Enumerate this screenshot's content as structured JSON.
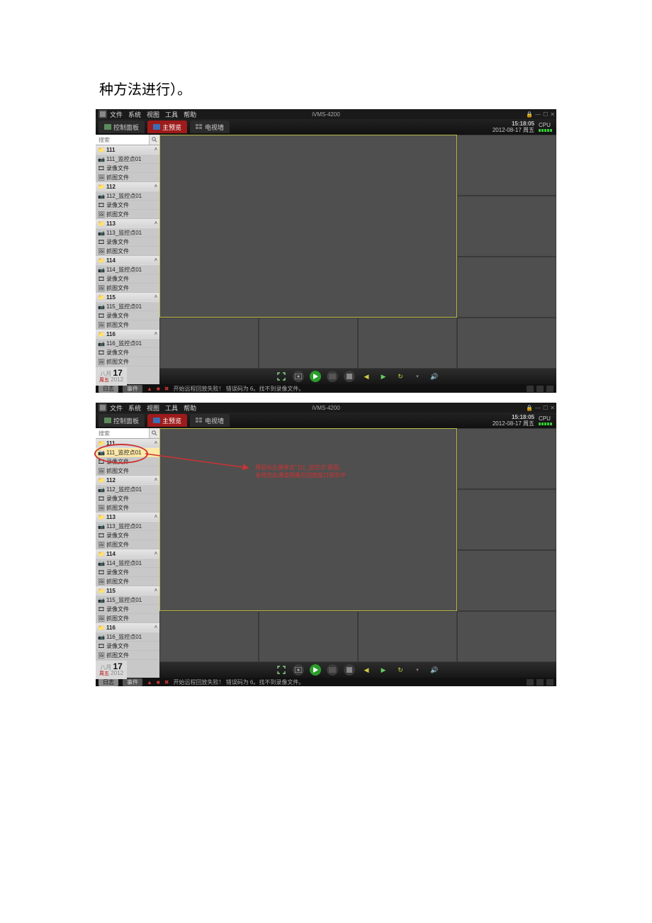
{
  "caption": "种方法进行）。",
  "app": {
    "title": "iVMS-4200",
    "menus": [
      "文件",
      "系统",
      "视图",
      "工具",
      "帮助"
    ],
    "window_buttons": [
      "lock-icon",
      "minimize-icon",
      "maximize-icon",
      "close-icon"
    ]
  },
  "tabs": [
    {
      "label": "控制面板",
      "icon": "panel"
    },
    {
      "label": "主预览",
      "icon": "screen",
      "active": true
    },
    {
      "label": "电视墙",
      "icon": "tvwall"
    }
  ],
  "clock": {
    "time": "15:18:05",
    "date": "2012-08-17",
    "weekday": "周五",
    "cpu_label": "CPU"
  },
  "search": {
    "placeholder": "搜索"
  },
  "groups": [
    {
      "name": "111",
      "items": [
        {
          "t": "cam",
          "l": "111_监控点01"
        },
        {
          "t": "rec",
          "l": "录像文件"
        },
        {
          "t": "pic",
          "l": "抓图文件"
        }
      ]
    },
    {
      "name": "112",
      "items": [
        {
          "t": "cam",
          "l": "112_监控点01"
        },
        {
          "t": "rec",
          "l": "录像文件"
        },
        {
          "t": "pic",
          "l": "抓图文件"
        }
      ]
    },
    {
      "name": "113",
      "items": [
        {
          "t": "cam",
          "l": "113_监控点01"
        },
        {
          "t": "rec",
          "l": "录像文件"
        },
        {
          "t": "pic",
          "l": "抓图文件"
        }
      ]
    },
    {
      "name": "114",
      "items": [
        {
          "t": "cam",
          "l": "114_监控点01"
        },
        {
          "t": "rec",
          "l": "录像文件"
        },
        {
          "t": "pic",
          "l": "抓图文件"
        }
      ]
    },
    {
      "name": "115",
      "items": [
        {
          "t": "cam",
          "l": "115_监控点01"
        },
        {
          "t": "rec",
          "l": "录像文件"
        },
        {
          "t": "pic",
          "l": "抓图文件"
        }
      ]
    },
    {
      "name": "116",
      "items": [
        {
          "t": "cam",
          "l": "116_监控点01"
        },
        {
          "t": "rec",
          "l": "录像文件"
        },
        {
          "t": "pic",
          "l": "抓图文件"
        }
      ]
    }
  ],
  "datebox": {
    "month": "八月",
    "day": "17",
    "weekday": "周五",
    "year": "2012"
  },
  "controls": [
    "fullscreen",
    "snapshot",
    "play",
    "record-all",
    "stop-all",
    "prev",
    "next",
    "cycle",
    "caret",
    "volume"
  ],
  "status": {
    "tabs": [
      "日志",
      "事件"
    ],
    "active_tab": 0,
    "icons": [
      "alarm-icon",
      "motion-icon",
      "error-icon"
    ],
    "message": "开始远程回放失败！ 错误码为 6。找不到录像文件。"
  },
  "annotation": {
    "line1": "用鼠标左键单击\"111_监控点\"画面，",
    "line2": "会预览此通道图像在回放窗口预览中"
  }
}
